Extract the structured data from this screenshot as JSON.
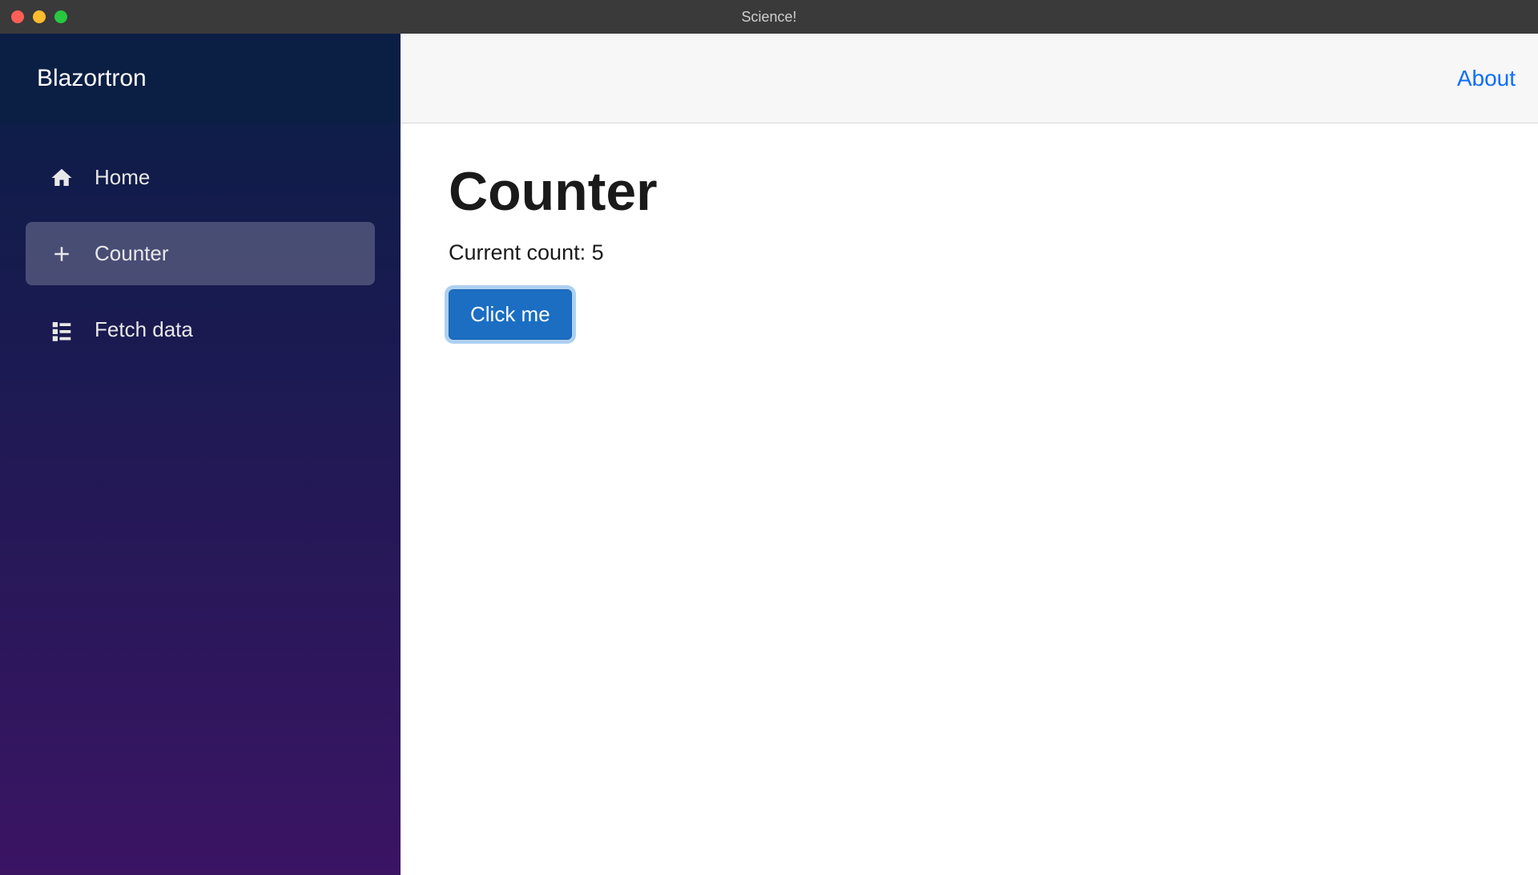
{
  "window": {
    "title": "Science!"
  },
  "sidebar": {
    "brand": "Blazortron",
    "items": [
      {
        "label": "Home",
        "icon": "home-icon",
        "active": false
      },
      {
        "label": "Counter",
        "icon": "plus-icon",
        "active": true
      },
      {
        "label": "Fetch data",
        "icon": "list-icon",
        "active": false
      }
    ]
  },
  "topbar": {
    "about_label": "About"
  },
  "main": {
    "title": "Counter",
    "count_text": "Current count: 5",
    "button_label": "Click me"
  }
}
